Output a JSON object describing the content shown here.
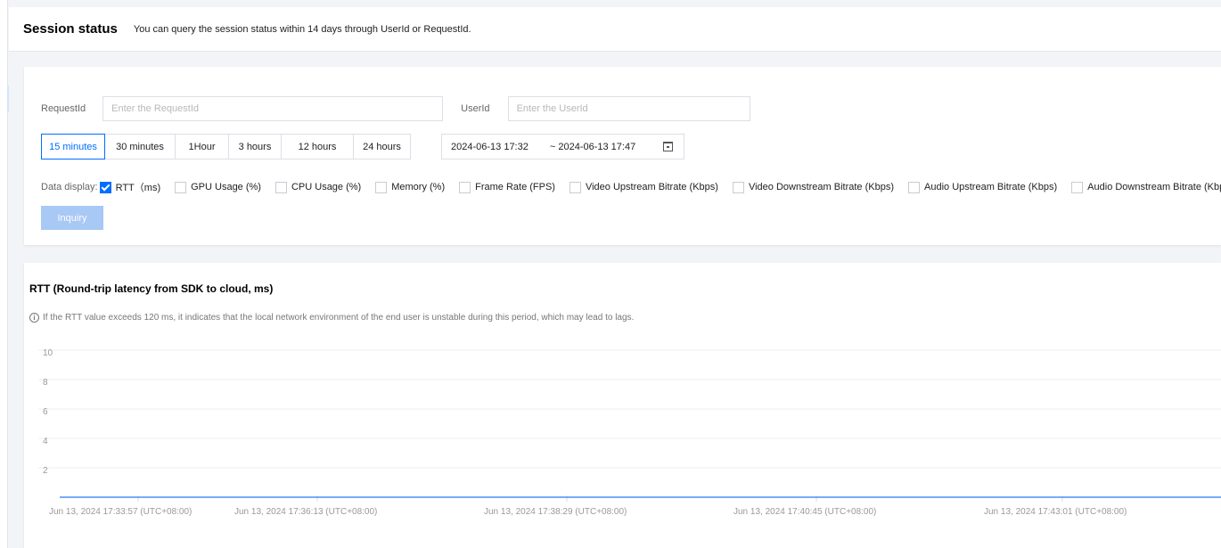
{
  "header": {
    "title": "Session status",
    "description": "You can query the session status within 14 days through UserId or RequestId."
  },
  "query": {
    "request_label": "RequestId",
    "request_placeholder": "Enter the RequestId",
    "user_label": "UserId",
    "user_placeholder": "Enter the UserId",
    "time_ranges": [
      {
        "label": "15 minutes",
        "active": true
      },
      {
        "label": "30 minutes",
        "active": false
      },
      {
        "label": "1Hour",
        "active": false
      },
      {
        "label": "3 hours",
        "active": false
      },
      {
        "label": "12 hours",
        "active": false
      },
      {
        "label": "24 hours",
        "active": false
      }
    ],
    "date_start": "2024-06-13 17:32",
    "date_end": "~ 2024-06-13 17:47",
    "calendar_icon": "calendar-icon",
    "display_label": "Data display:",
    "metrics": [
      {
        "label": "RTT（ms)",
        "checked": true
      },
      {
        "label": "GPU Usage (%)",
        "checked": false
      },
      {
        "label": "CPU Usage (%)",
        "checked": false
      },
      {
        "label": "Memory (%)",
        "checked": false
      },
      {
        "label": "Frame Rate (FPS)",
        "checked": false
      },
      {
        "label": "Video Upstream Bitrate (Kbps)",
        "checked": false
      },
      {
        "label": "Video Downstream Bitrate (Kbps)",
        "checked": false
      },
      {
        "label": "Audio Upstream Bitrate (Kbps)",
        "checked": false
      },
      {
        "label": "Audio Downstream Bitrate (Kbps)",
        "checked": false
      }
    ],
    "inquiry_label": "Inquiry"
  },
  "rtt_panel": {
    "title": "RTT (Round-trip latency from SDK to cloud, ms)",
    "note": "If the RTT value exceeds 120 ms, it indicates that the local network environment of the end user is unstable during this period, which may lead to lags.",
    "info_icon": "info-icon"
  },
  "chart_data": {
    "type": "line",
    "title": "RTT (Round-trip latency from SDK to cloud, ms)",
    "ylim": [
      0,
      10
    ],
    "yticks": [
      2,
      4,
      6,
      8,
      10
    ],
    "x_tick_labels": [
      "Jun 13, 2024 17:33:57 (UTC+08:00)",
      "Jun 13, 2024 17:36:13 (UTC+08:00)",
      "Jun 13, 2024 17:38:29 (UTC+08:00)",
      "Jun 13, 2024 17:40:45 (UTC+08:00)",
      "Jun 13, 2024 17:43:01 (UTC+08:00)"
    ],
    "series": [
      {
        "color": "#4c8ef5",
        "values": [
          0,
          0,
          0,
          0,
          0,
          0,
          0,
          0,
          0,
          0,
          0
        ]
      }
    ],
    "grid": true
  }
}
